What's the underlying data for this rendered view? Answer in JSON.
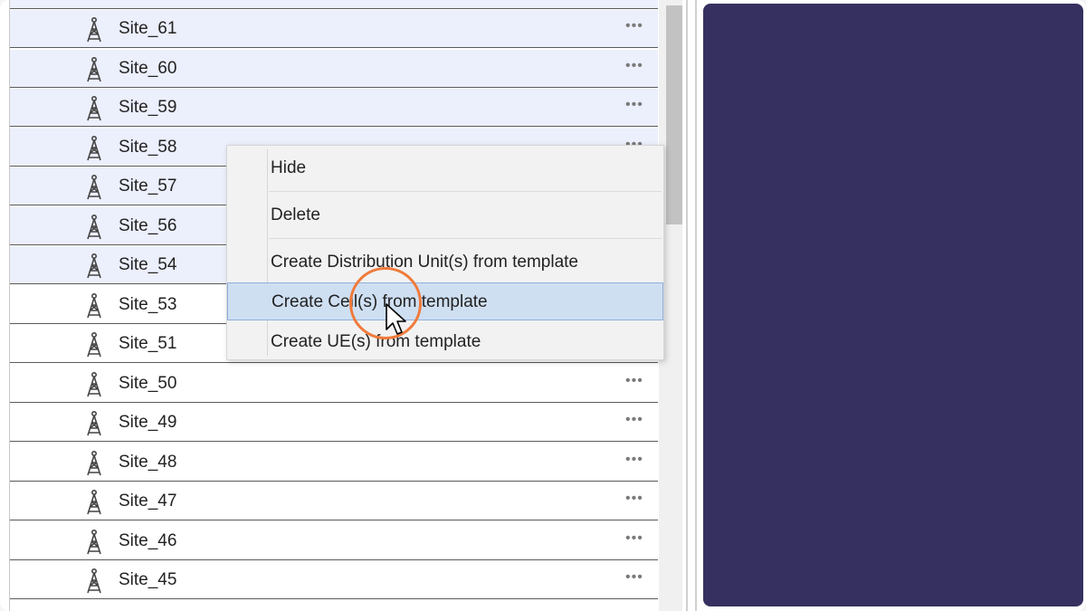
{
  "site_list": {
    "rows": [
      {
        "label": "Site_61",
        "selected": true,
        "more": "•••"
      },
      {
        "label": "Site_60",
        "selected": true,
        "more": "•••"
      },
      {
        "label": "Site_59",
        "selected": true,
        "more": "•••"
      },
      {
        "label": "Site_58",
        "selected": true,
        "more": "•••"
      },
      {
        "label": "Site_57",
        "selected": true,
        "more": ""
      },
      {
        "label": "Site_56",
        "selected": true,
        "more": ""
      },
      {
        "label": "Site_54",
        "selected": true,
        "more": ""
      },
      {
        "label": "Site_53",
        "selected": false,
        "more": ""
      },
      {
        "label": "Site_51",
        "selected": false,
        "more": ""
      },
      {
        "label": "Site_50",
        "selected": false,
        "more": "•••"
      },
      {
        "label": "Site_49",
        "selected": false,
        "more": "•••"
      },
      {
        "label": "Site_48",
        "selected": false,
        "more": "•••"
      },
      {
        "label": "Site_47",
        "selected": false,
        "more": "•••"
      },
      {
        "label": "Site_46",
        "selected": false,
        "more": "•••"
      },
      {
        "label": "Site_45",
        "selected": false,
        "more": "•••"
      }
    ],
    "row_icon": "radio-tower-icon"
  },
  "context_menu": {
    "items": [
      {
        "label": "Hide",
        "highlighted": false
      },
      {
        "label": "Delete",
        "highlighted": false
      },
      {
        "label": "Create Distribution Unit(s) from template",
        "highlighted": false
      },
      {
        "label": "Create Cell(s) from template",
        "highlighted": true
      },
      {
        "label": "Create UE(s) from template",
        "highlighted": false
      }
    ]
  },
  "colors": {
    "selected_row": "#eceffc",
    "menu_highlight": "#cfdff2",
    "right_panel": "#35305f",
    "click_ring": "#f07a3b"
  },
  "pointer_icon": "arrow-cursor-icon"
}
